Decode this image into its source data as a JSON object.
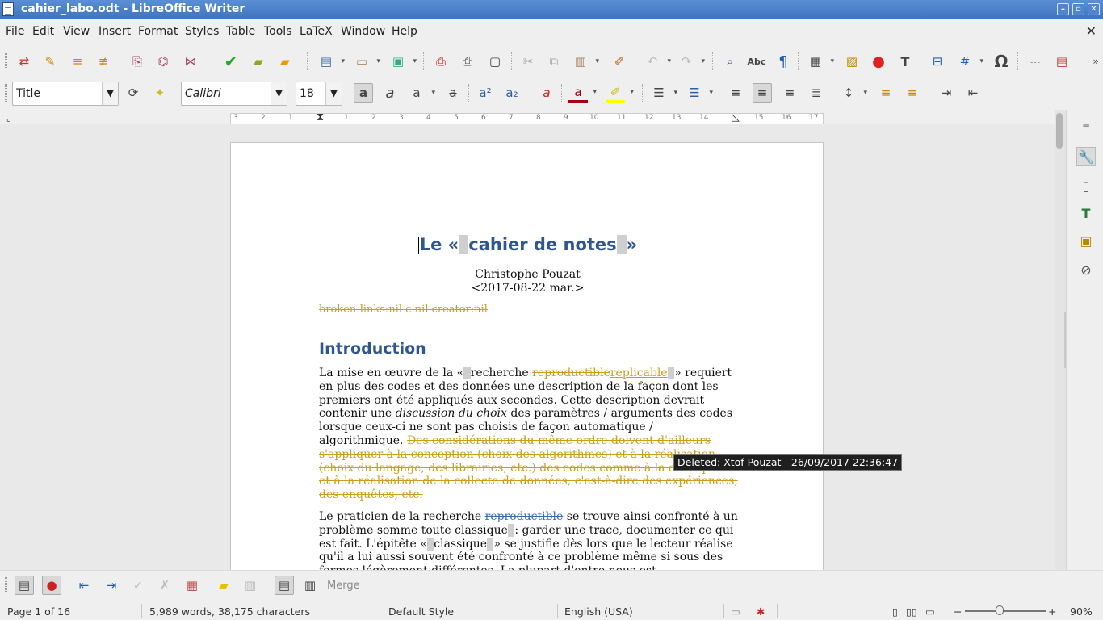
{
  "window": {
    "title": "cahier_labo.odt - LibreOffice Writer"
  },
  "menubar": {
    "items": [
      "File",
      "Edit",
      "View",
      "Insert",
      "Format",
      "Styles",
      "Table",
      "Tools",
      "LaTeX",
      "Window",
      "Help"
    ]
  },
  "formatting": {
    "paragraph_style": "Title",
    "font_name": "Calibri",
    "font_size": "18"
  },
  "ruler": {
    "marks": [
      "3",
      "2",
      "1",
      "1",
      "2",
      "3",
      "4",
      "5",
      "6",
      "7",
      "8",
      "9",
      "10",
      "11",
      "12",
      "13",
      "14",
      "15",
      "16",
      "17",
      "18"
    ]
  },
  "document": {
    "title_open": "Le «",
    "title_main": "cahier de notes",
    "title_close": "»",
    "author": "Christophe Pouzat",
    "date": "<2017-08-22 mar.>",
    "meta_deleted": "broken-links:nil c:nil creator:nil",
    "heading_intro": "Introduction",
    "p1_a": "La mise en œuvre de la «",
    "p1_b": "recherche",
    "p1_deleted": "reproductible",
    "p1_inserted": "replicable",
    "p1_c": "» requiert en plus des codes et des données une description de la façon dont les premiers ont été appliqués aux secondes. Cette description devrait contenir une",
    "p1_italic": "discussion du choix",
    "p1_d": "des paramètres / arguments des codes lorsque ceux-ci ne sont pas choisis de façon automatique / algorithmique.",
    "p1_deleted_long": "Des considérations du même ordre doivent d'ailleurs s'appliquer à la conception (choix des algorithmes) et à la réalisation (choix du langage, des librairies, etc.) des codes comme à la conception et à la réalisation de la collecte de données, c'est-à-dire des expériences, des enquêtes, etc.",
    "p2_a": "Le praticien de la recherche",
    "p2_deleted": "reproductible",
    "p2_b": "se trouve ainsi confronté à un problème somme toute classique",
    "p2_c": ": garder une trace, documenter ce qui est fait. L'épitête «",
    "p2_d": "classique",
    "p2_e": "» se justifie dès lors que le lecteur réalise qu'il a lui aussi souvent été confronté à ce problème même si sous des formes légèrement différentes. La plupart d'entre nous est"
  },
  "tooltip": {
    "text": "Deleted: Xtof Pouzat - 26/09/2017 22:36:47"
  },
  "track_changes_toolbar": {
    "merge_label": "Merge"
  },
  "statusbar": {
    "page": "Page 1 of 16",
    "words": "5,989 words, 38,175 characters",
    "page_style": "Default Style",
    "language": "English (USA)",
    "zoom": "90%"
  },
  "colors": {
    "heading": "#2e5691",
    "tracked_change": "#c8a020",
    "titlebar": "#4a82cc"
  }
}
